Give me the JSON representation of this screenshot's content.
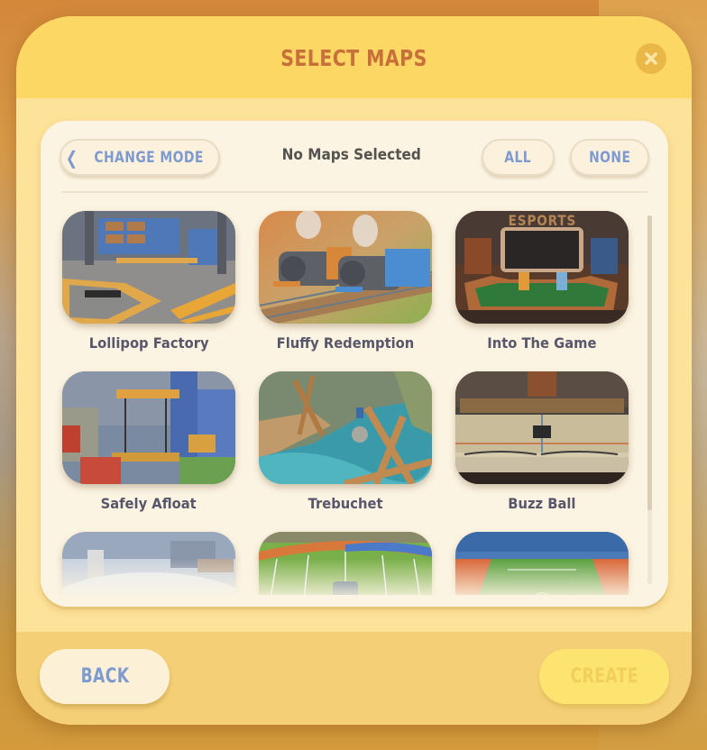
{
  "modal": {
    "title": "SELECT MAPS",
    "close_icon": "close-x-icon"
  },
  "toolbar": {
    "change_mode_icon": "chevron-left-icon",
    "change_mode_label": "CHANGE MODE",
    "selection_status": "No Maps Selected",
    "all_label": "ALL",
    "none_label": "NONE"
  },
  "maps": [
    {
      "name": "Lollipop Factory"
    },
    {
      "name": "Fluffy Redemption"
    },
    {
      "name": "Into The Game"
    },
    {
      "name": "Safely Afloat"
    },
    {
      "name": "Trebuchet"
    },
    {
      "name": "Buzz Ball"
    },
    {
      "name": ""
    },
    {
      "name": ""
    },
    {
      "name": ""
    }
  ],
  "thumbnail_text": {
    "esports_sign": "ESPORTS"
  },
  "footer": {
    "back_label": "BACK",
    "create_label": "CREATE",
    "create_enabled": false
  },
  "colors": {
    "title": "#c8703a",
    "button_text": "#7d9bd1",
    "map_name": "#58566a",
    "header_bg": "#fdd764",
    "panel_bg": "#fcf4e2"
  }
}
